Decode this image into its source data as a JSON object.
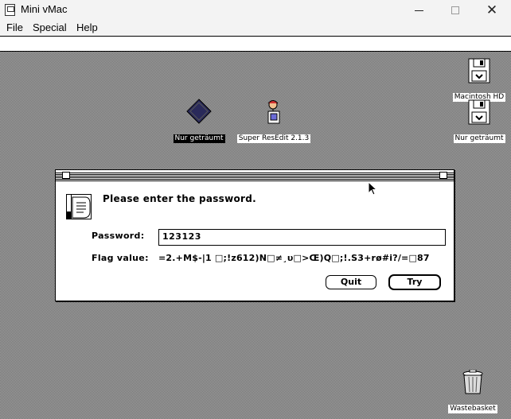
{
  "window": {
    "title": "Mini vMac",
    "app_icon": "mac-classic-icon",
    "controls": [
      "minimize-icon",
      "maximize-icon",
      "close-icon"
    ],
    "close_glyph": "✕"
  },
  "menubar": {
    "items": [
      {
        "label": "File"
      },
      {
        "label": "Special"
      },
      {
        "label": "Help"
      }
    ]
  },
  "desktop": {
    "icons": [
      {
        "label": "Nur geträumt",
        "icon": "document-icon",
        "selected": true
      },
      {
        "label": "Super ResEdit 2.1.3",
        "icon": "jack-in-the-box-icon",
        "selected": false
      },
      {
        "label": "Macintosh HD",
        "icon": "floppy-disk-icon",
        "selected": false
      },
      {
        "label": "Nur geträumt",
        "icon": "floppy-disk-icon",
        "selected": false
      },
      {
        "label": "Wastebasket",
        "icon": "trash-can-icon",
        "selected": false
      }
    ]
  },
  "dialog": {
    "icon": "note-icon",
    "message": "Please enter the password.",
    "password_label": "Password:",
    "password_value": "123123",
    "flag_label": "Flag value:",
    "flag_value": "=2.+M$-|1 □;!z612)N□≠¸υ□>Œ)Q□;!.S3+rø#i?/=□87",
    "buttons": {
      "quit": "Quit",
      "try": "Try"
    }
  },
  "colors": {
    "desktop_light": "#a4a4a4",
    "desktop_dark": "#6f6f6f",
    "chrome_bg": "#f3f3f3"
  }
}
